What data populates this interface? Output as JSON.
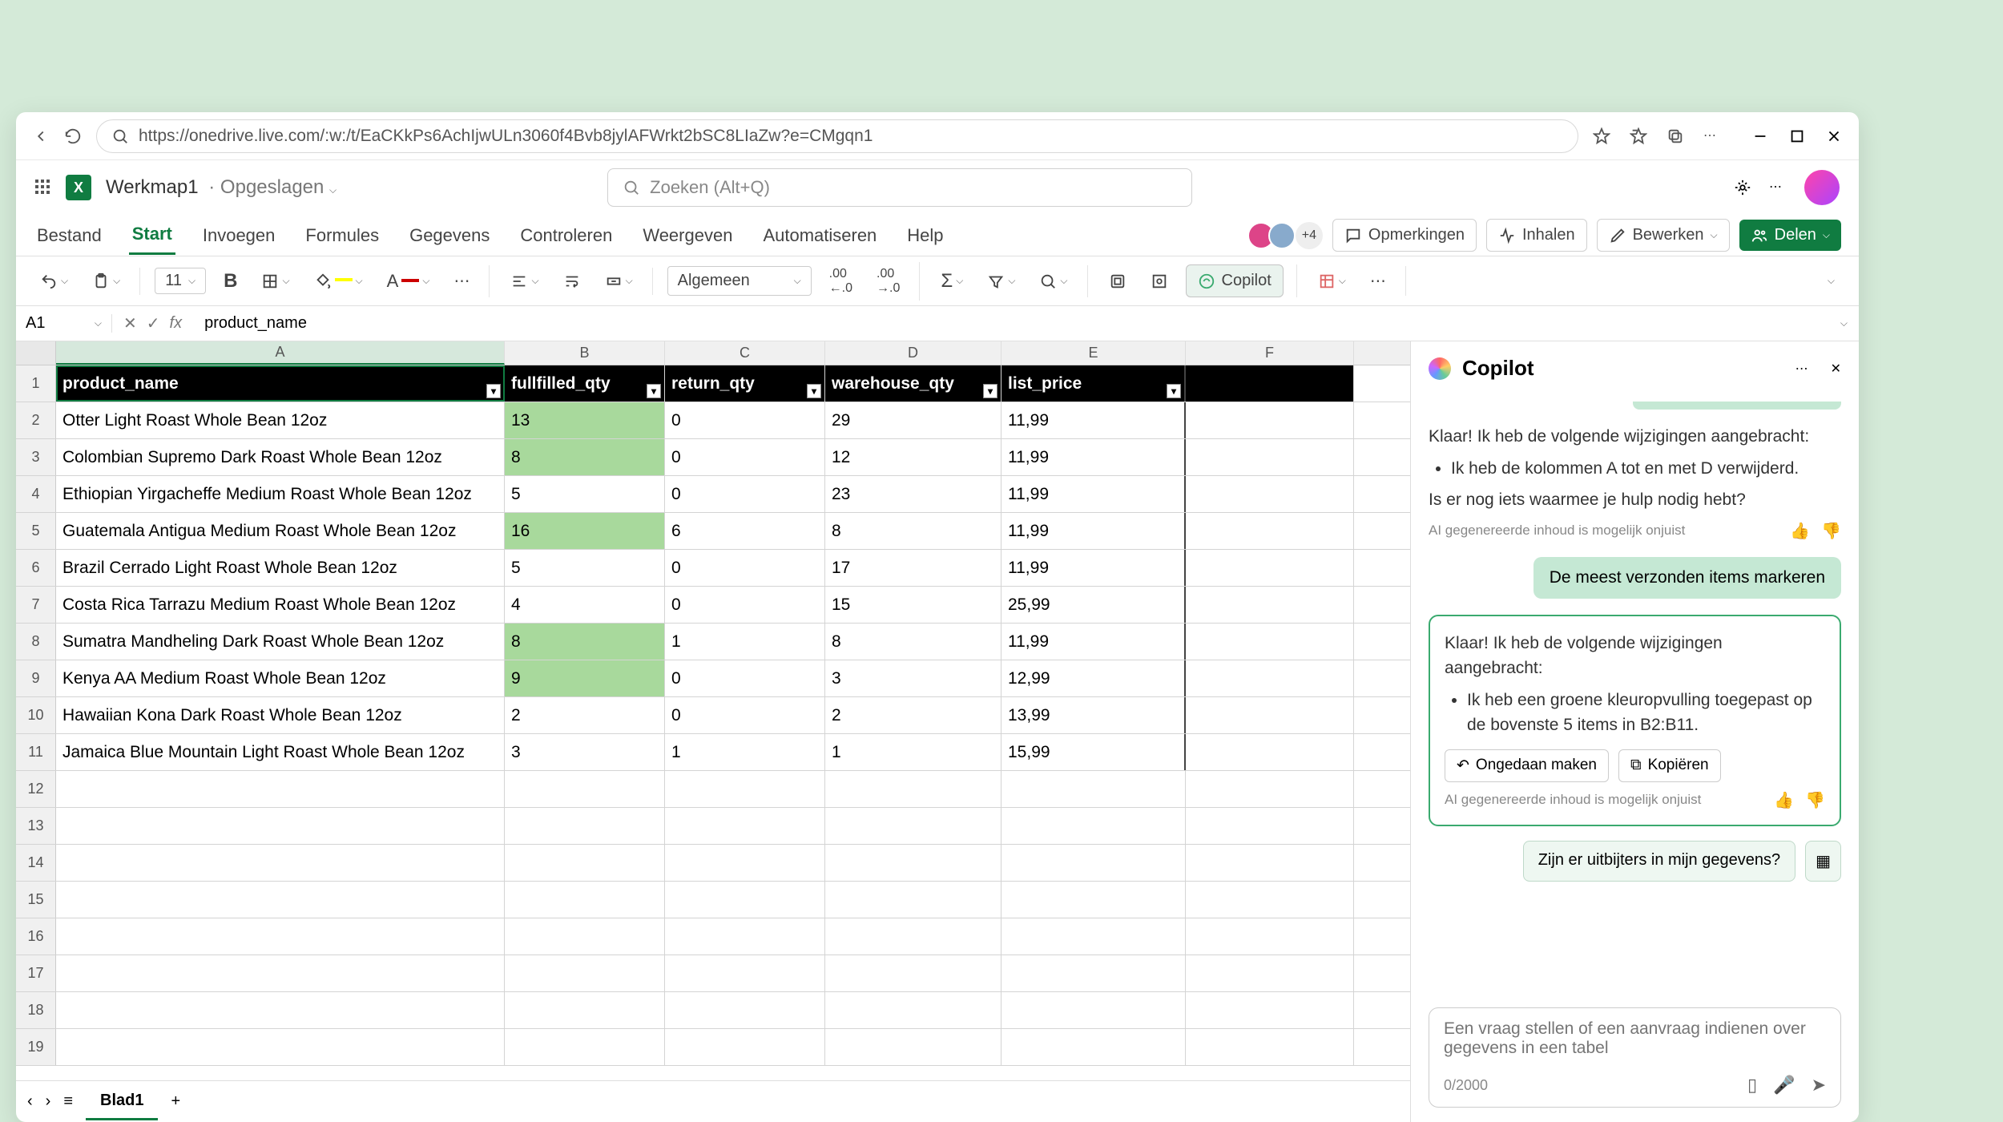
{
  "browser": {
    "url": "https://onedrive.live.com/:w:/t/EaCKkPs6AchIjwULn3060f4Bvb8jylAFWrkt2bSC8LIaZw?e=CMgqn1"
  },
  "file": {
    "name": "Werkmap1",
    "status": "Opgeslagen"
  },
  "search": {
    "placeholder": "Zoeken (Alt+Q)"
  },
  "tabs": {
    "file": "Bestand",
    "home": "Start",
    "insert": "Invoegen",
    "formulas": "Formules",
    "data": "Gegevens",
    "review": "Controleren",
    "view": "Weergeven",
    "automate": "Automatiseren",
    "help": "Help"
  },
  "ribbon_right": {
    "presence_more": "+4",
    "comments": "Opmerkingen",
    "catchup": "Inhalen",
    "editing": "Bewerken",
    "share": "Delen"
  },
  "toolbar": {
    "font_size": "11",
    "number_format": "Algemeen",
    "copilot": "Copilot"
  },
  "name_box": "A1",
  "formula": "product_name",
  "columns": [
    "A",
    "B",
    "C",
    "D",
    "E",
    "F"
  ],
  "table": {
    "headers": [
      "product_name",
      "fullfilled_qty",
      "return_qty",
      "warehouse_qty",
      "list_price"
    ],
    "rows": [
      {
        "n": 2,
        "a": "Otter Light Roast Whole Bean 12oz",
        "b": "13",
        "c": "0",
        "d": "29",
        "e": "11,99",
        "hl": true
      },
      {
        "n": 3,
        "a": "Colombian Supremo Dark Roast Whole Bean 12oz",
        "b": "8",
        "c": "0",
        "d": "12",
        "e": "11,99",
        "hl": true
      },
      {
        "n": 4,
        "a": "Ethiopian Yirgacheffe Medium Roast Whole Bean 12oz",
        "b": "5",
        "c": "0",
        "d": "23",
        "e": "11,99",
        "hl": false
      },
      {
        "n": 5,
        "a": "Guatemala Antigua Medium Roast Whole Bean 12oz",
        "b": "16",
        "c": "6",
        "d": "8",
        "e": "11,99",
        "hl": true
      },
      {
        "n": 6,
        "a": "Brazil Cerrado Light Roast Whole Bean 12oz",
        "b": "5",
        "c": "0",
        "d": "17",
        "e": "11,99",
        "hl": false
      },
      {
        "n": 7,
        "a": "Costa Rica Tarrazu Medium Roast Whole Bean 12oz",
        "b": "4",
        "c": "0",
        "d": "15",
        "e": "25,99",
        "hl": false
      },
      {
        "n": 8,
        "a": "Sumatra Mandheling Dark Roast Whole Bean 12oz",
        "b": "8",
        "c": "1",
        "d": "8",
        "e": "11,99",
        "hl": true
      },
      {
        "n": 9,
        "a": "Kenya AA Medium Roast Whole Bean 12oz",
        "b": "9",
        "c": "0",
        "d": "3",
        "e": "12,99",
        "hl": true
      },
      {
        "n": 10,
        "a": "Hawaiian Kona Dark Roast Whole Bean 12oz",
        "b": "2",
        "c": "0",
        "d": "2",
        "e": "13,99",
        "hl": false
      },
      {
        "n": 11,
        "a": "Jamaica Blue Mountain Light Roast Whole Bean 12oz",
        "b": "3",
        "c": "1",
        "d": "1",
        "e": "15,99",
        "hl": false
      }
    ],
    "empty_rows": [
      12,
      13,
      14,
      15,
      16,
      17,
      18,
      19
    ]
  },
  "sheet": {
    "name": "Blad1"
  },
  "copilot": {
    "title": "Copilot",
    "msg1_intro": "Klaar! Ik heb de volgende wijzigingen aangebracht:",
    "msg1_bullet": "Ik heb de kolommen A tot en met D verwijderd.",
    "msg1_follow": "Is er nog iets waarmee je hulp nodig hebt?",
    "disclaimer": "AI gegenereerde inhoud is mogelijk onjuist",
    "user_prompt": "De meest verzonden items markeren",
    "msg2_intro": "Klaar! Ik heb de volgende wijzigingen aangebracht:",
    "msg2_bullet": "Ik heb een groene kleuropvulling toegepast op de bovenste 5 items in B2:B11.",
    "undo": "Ongedaan maken",
    "copy": "Kopiëren",
    "suggestion": "Zijn er uitbijters in mijn gegevens?",
    "input_placeholder": "Een vraag stellen of een aanvraag indienen over gegevens in een tabel",
    "counter": "0/2000"
  }
}
